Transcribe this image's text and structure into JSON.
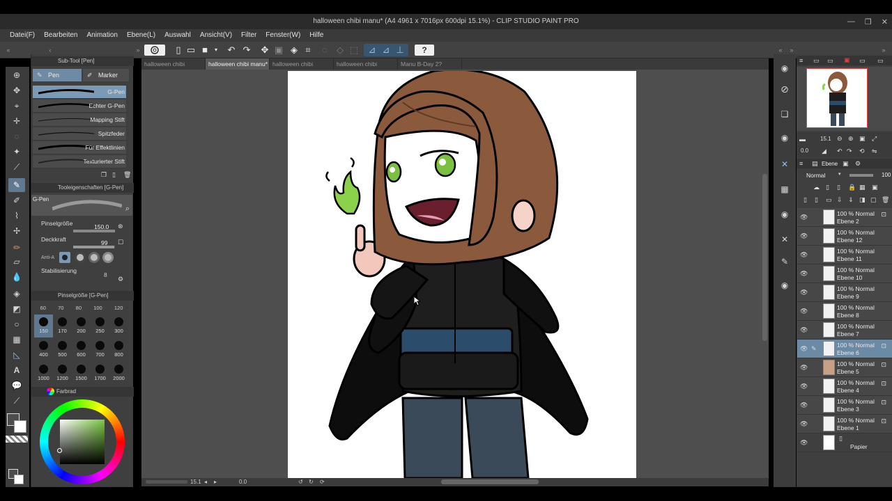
{
  "window": {
    "title": "halloween chibi manu* (A4 4961 x 7016px 600dpi 15.1%)  - CLIP STUDIO PAINT PRO",
    "minimize": "—",
    "maximize": "❐",
    "close": "✕"
  },
  "menu": [
    {
      "label": "Datei(F)"
    },
    {
      "label": "Bearbeiten"
    },
    {
      "label": "Animation"
    },
    {
      "label": "Ebene(L)"
    },
    {
      "label": "Auswahl"
    },
    {
      "label": "Ansicht(V)"
    },
    {
      "label": "Filter"
    },
    {
      "label": "Fenster(W)"
    },
    {
      "label": "Hilfe"
    }
  ],
  "tabs": [
    {
      "label": "halloween chibi"
    },
    {
      "label": "halloween chibi manu*"
    },
    {
      "label": "halloween chibi"
    },
    {
      "label": "halloween chibi"
    },
    {
      "label": "Manu B-Day 2?"
    }
  ],
  "subtool": {
    "header": "Sub-Tool [Pen]",
    "tab_pen": "Pen",
    "tab_marker": "Marker",
    "brushes": [
      {
        "name": "G-Pen"
      },
      {
        "name": "Echter G-Pen"
      },
      {
        "name": "Mapping Stift"
      },
      {
        "name": "Spitzfeder"
      },
      {
        "name": "Für Effektlinien"
      },
      {
        "name": "Texturierter Stift"
      }
    ]
  },
  "tool_properties": {
    "header": "Tooleigenschaften [G-Pen]",
    "preview_name": "G-Pen",
    "brush_size_label": "Pinselgröße",
    "brush_size_value": "150.0",
    "opacity_label": "Deckkraft",
    "opacity_value": "99",
    "opacity_level": 0.99,
    "antialias_label": "Anti-A",
    "stabilization_label": "Stabilisierung",
    "stabilization_value": "8"
  },
  "brush_size_panel": {
    "header": "Pinselgröße [G-Pen]",
    "column_heads": [
      "60",
      "70",
      "80",
      "100",
      "120"
    ],
    "sizes": [
      "150",
      "170",
      "200",
      "250",
      "300",
      "400",
      "500",
      "600",
      "700",
      "800",
      "1000",
      "1200",
      "1500",
      "1700",
      "2000"
    ]
  },
  "color": {
    "header": "Farbrad",
    "main_color": "#4d4d4d",
    "sub_color": "#ffffff",
    "wheel_color": "#7cc940"
  },
  "canvas": {
    "zoom": "15.1",
    "angle": "0.0"
  },
  "navigator": {
    "zoom": "15.1",
    "angle": "0.0"
  },
  "layers": {
    "tab_label": "Ebene",
    "blend_mode": "Normal",
    "opacity": "100",
    "items": [
      {
        "mode": "100 % Normal",
        "name": "Ebene 2"
      },
      {
        "mode": "100 % Normal",
        "name": "Ebene 12"
      },
      {
        "mode": "100 % Normal",
        "name": "Ebene 11"
      },
      {
        "mode": "100 % Normal",
        "name": "Ebene 10"
      },
      {
        "mode": "100 % Normal",
        "name": "Ebene 9"
      },
      {
        "mode": "100 % Normal",
        "name": "Ebene 8"
      },
      {
        "mode": "100 % Normal",
        "name": "Ebene 7"
      },
      {
        "mode": "100 % Normal",
        "name": "Ebene 6"
      },
      {
        "mode": "100 % Normal",
        "name": "Ebene 5"
      },
      {
        "mode": "100 % Normal",
        "name": "Ebene 4"
      },
      {
        "mode": "100 % Normal",
        "name": "Ebene 3"
      },
      {
        "mode": "100 % Normal",
        "name": "Ebene 1"
      }
    ],
    "paper_name": "Papier"
  }
}
